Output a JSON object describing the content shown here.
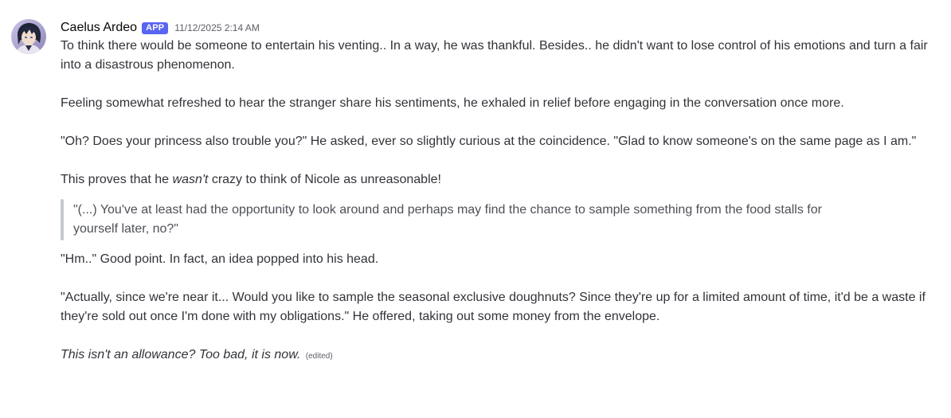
{
  "message": {
    "author": "Caelus Ardeo",
    "badge": "APP",
    "timestamp": "11/12/2025 2:14 AM",
    "paragraphs": {
      "p1": "To think there would be someone to entertain his venting.. In a way, he was thankful. Besides.. he didn't want to lose control of his emotions and turn a fair into a disastrous phenomenon.",
      "p2": "Feeling somewhat refreshed to hear the stranger share his sentiments, he exhaled in relief before engaging in the conversation once more.",
      "p3": "\"Oh? Does your princess also trouble you?\" He asked, ever so slightly curious at the coincidence. \"Glad to know someone's on the same page as I am.\"",
      "p4_before": "This proves that he ",
      "p4_italic": "wasn't",
      "p4_after": " crazy to think of Nicole as unreasonable!",
      "quote": "\"(...)  You've at least had the opportunity to look around and perhaps may find the chance to sample something from the food stalls for yourself later, no?\"",
      "p5": "\"Hm..\" Good point. In fact, an idea popped into his head.",
      "p6": "\"Actually, since we're near it... Would you like to sample the seasonal exclusive doughnuts? Since they're up for a limited amount of time, it'd be a waste if they're sold out once I'm done with my obligations.\" He offered, taking out some money from the envelope.",
      "p7": "This isn't an allowance? Too bad, it is now.",
      "edited": "(edited)"
    },
    "colors": {
      "badge_bg": "#5865f2",
      "text": "#313338",
      "quote_bar": "#c4c9ce"
    }
  }
}
